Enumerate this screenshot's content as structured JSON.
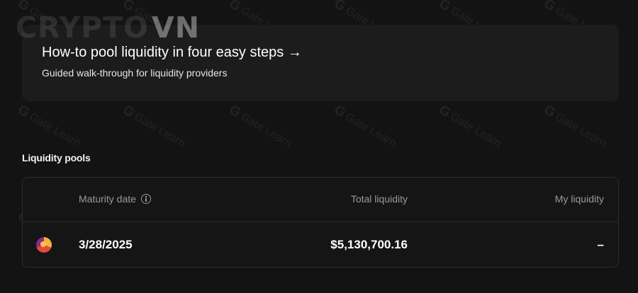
{
  "logo": {
    "text_main": "CRYPTO",
    "text_accent": "VN"
  },
  "watermark": {
    "text": "Gate Learn"
  },
  "banner": {
    "title": "How-to pool liquidity in four easy steps →",
    "subtitle": "Guided walk-through for liquidity providers"
  },
  "pools": {
    "section_title": "Liquidity pools",
    "columns": {
      "maturity": "Maturity date",
      "total": "Total liquidity",
      "mine": "My liquidity"
    },
    "rows": [
      {
        "maturity": "3/28/2025",
        "total": "$5,130,700.16",
        "mine": "–"
      }
    ]
  },
  "colors": {
    "background": "#131313",
    "card": "#1c1c1c",
    "muted_text": "#9a9a9a"
  },
  "icons": {
    "info": "info-icon",
    "token": "token-icon"
  }
}
